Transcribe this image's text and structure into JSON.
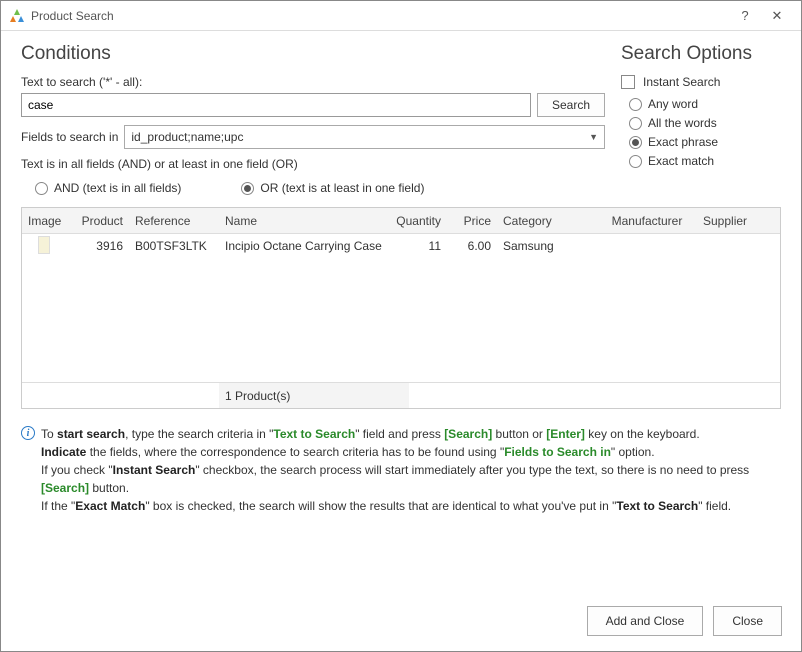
{
  "window": {
    "title": "Product Search"
  },
  "conditions": {
    "heading": "Conditions",
    "text_label": "Text to search ('*' - all):",
    "text_value": "case",
    "search_btn": "Search",
    "fields_label": "Fields to search in",
    "fields_value": "id_product;name;upc",
    "logic_label": "Text is in all fields (AND) or at least in one field (OR)",
    "and_label": "AND (text is in all fields)",
    "or_label": "OR (text is at least in one field)",
    "logic_selected": "or"
  },
  "options": {
    "heading": "Search Options",
    "instant_label": "Instant Search",
    "instant_checked": false,
    "mode_selected": "exact_phrase",
    "modes": {
      "any_word": "Any word",
      "all_words": "All the words",
      "exact_phrase": "Exact phrase",
      "exact_match": "Exact match"
    }
  },
  "grid": {
    "headers": {
      "image": "Image",
      "product": "Product",
      "reference": "Reference",
      "name": "Name",
      "quantity": "Quantity",
      "price": "Price",
      "category": "Category",
      "manufacturer": "Manufacturer",
      "supplier": "Supplier"
    },
    "rows": [
      {
        "product": "3916",
        "reference": "B00TSF3LTK",
        "name": "Incipio Octane Carrying Case",
        "quantity": "11",
        "price": "6.00",
        "category": "Samsung",
        "manufacturer": "",
        "supplier": ""
      }
    ],
    "footer_count": "1 Product(s)"
  },
  "info": {
    "l1a": "To ",
    "l1b": "start search",
    "l1c": ", type the search criteria in \"",
    "l1d": "Text to Search",
    "l1e": "\" field and press ",
    "l1f": "[Search]",
    "l1g": " button or ",
    "l1h": "[Enter]",
    "l1i": " key on the keyboard.",
    "l2a": "Indicate",
    "l2b": " the fields, where the correspondence to search criteria has to be found using \"",
    "l2c": "Fields to Search in",
    "l2d": "\" option.",
    "l3a": "If you check \"",
    "l3b": "Instant Search",
    "l3c": "\" checkbox, the search process will start immediately after you type the text, so there is no need to press ",
    "l3d": "[Search]",
    "l3e": " button.",
    "l4a": "If the \"",
    "l4b": "Exact Match",
    "l4c": "\" box is checked, the search will show the results that are identical to what you've put in \"",
    "l4d": "Text to Search",
    "l4e": "\" field."
  },
  "footer": {
    "add_close": "Add and Close",
    "close": "Close"
  }
}
